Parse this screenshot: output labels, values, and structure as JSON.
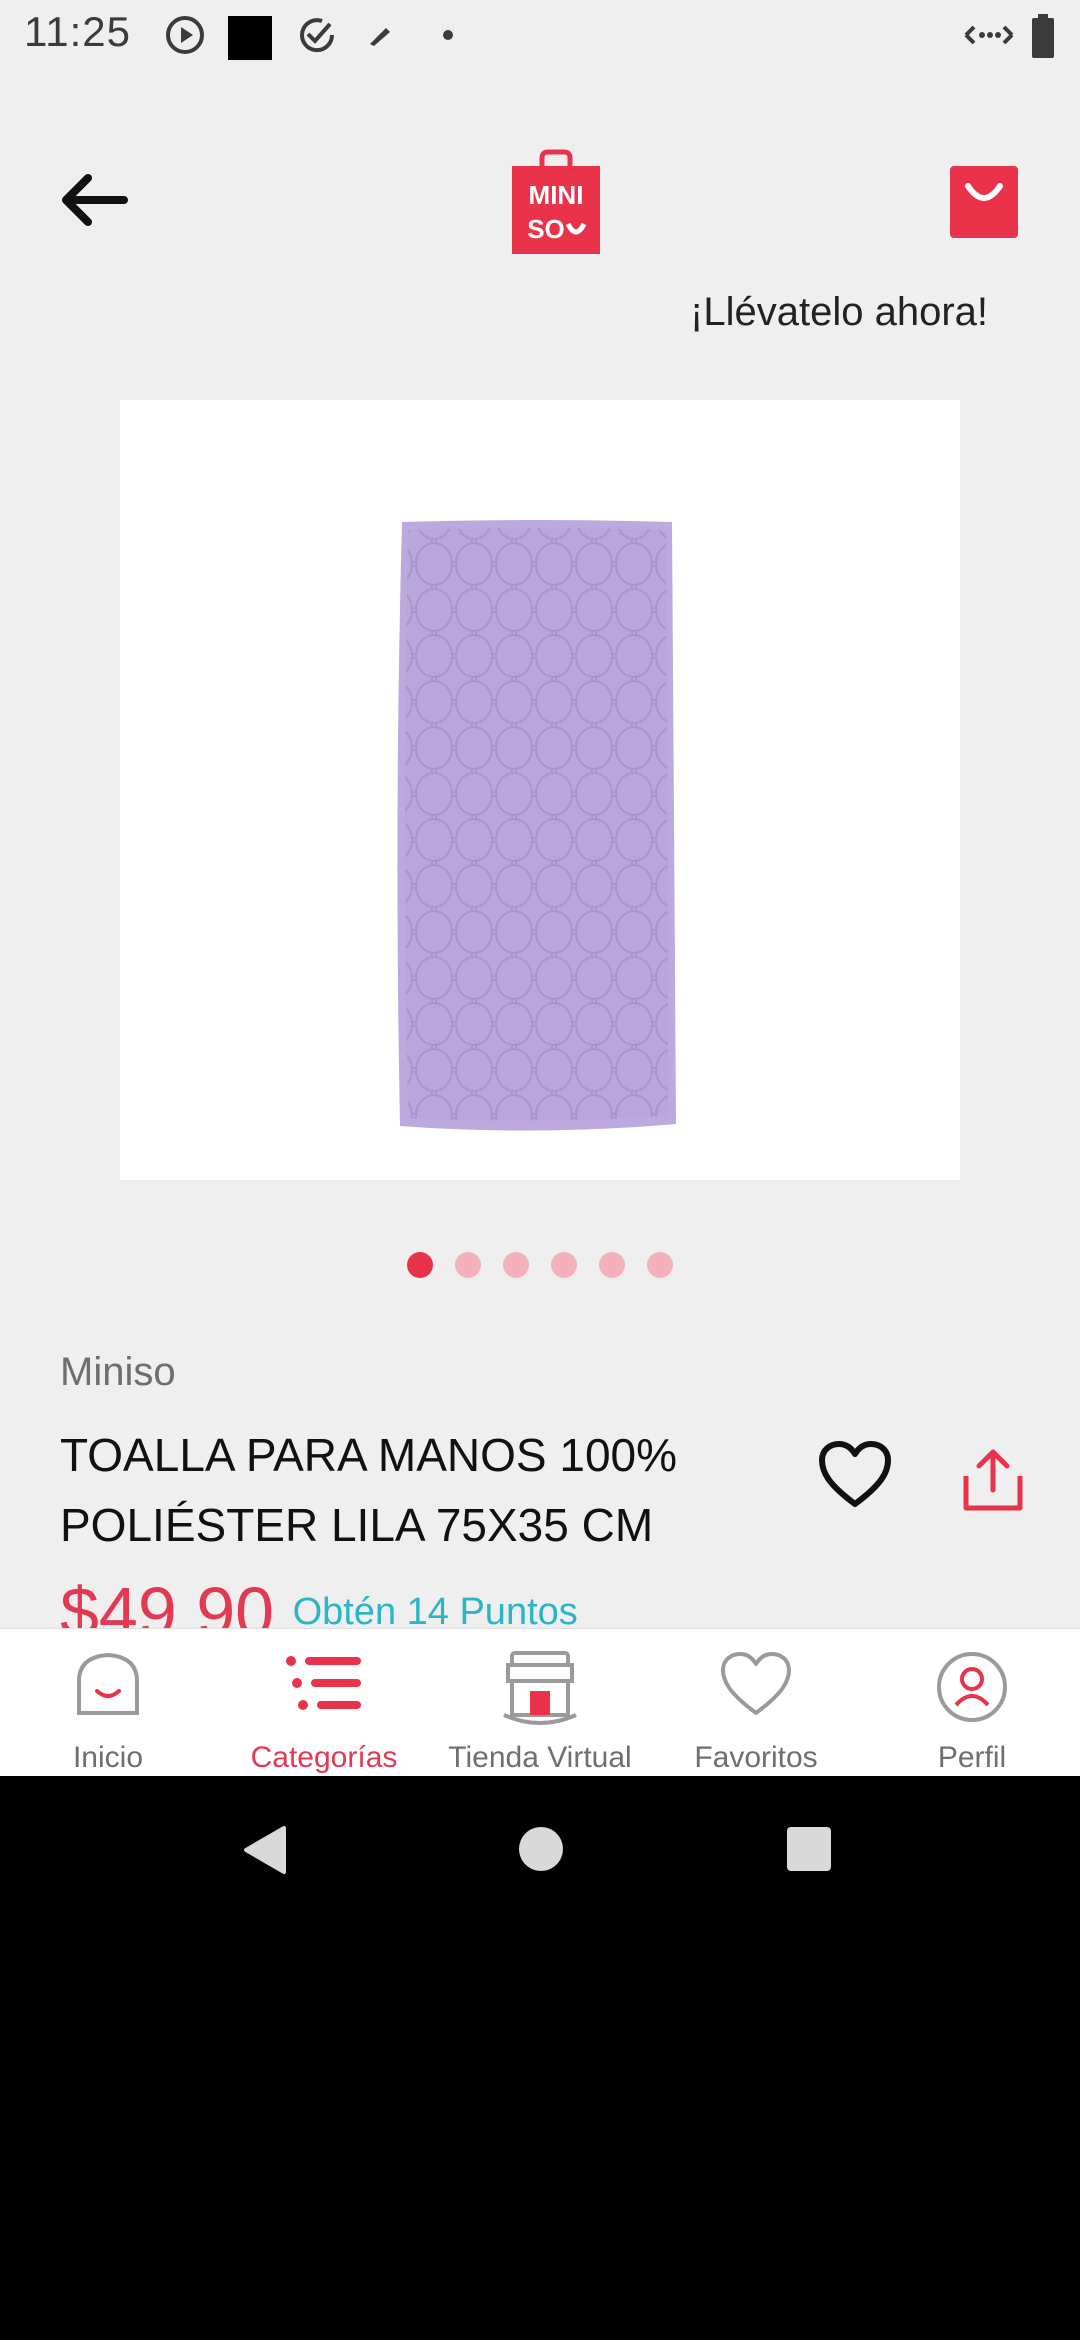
{
  "status_bar": {
    "time": "11:25"
  },
  "header": {
    "logo_text_line1": "MINI",
    "logo_text_line2": "SO",
    "promo_text": "¡Llévatelo ahora!"
  },
  "carousel": {
    "total_dots": 6,
    "active_index": 0
  },
  "product": {
    "brand": "Miniso",
    "title": "TOALLA PARA MANOS 100% POLIÉSTER LILA 75X35 CM",
    "price": "$49.90",
    "points": "Obtén 14 Puntos"
  },
  "bottom_nav": {
    "items": [
      {
        "label": "Inicio",
        "icon": "home-bag-icon",
        "active": false
      },
      {
        "label": "Categorías",
        "icon": "list-icon",
        "active": true
      },
      {
        "label": "Tienda Virtual",
        "icon": "store-icon",
        "active": false
      },
      {
        "label": "Favoritos",
        "icon": "heart-icon",
        "active": false
      },
      {
        "label": "Perfil",
        "icon": "user-icon",
        "active": false
      }
    ]
  },
  "colors": {
    "accent": "#e23a52",
    "points": "#2ab6c6",
    "background": "#efefef"
  }
}
